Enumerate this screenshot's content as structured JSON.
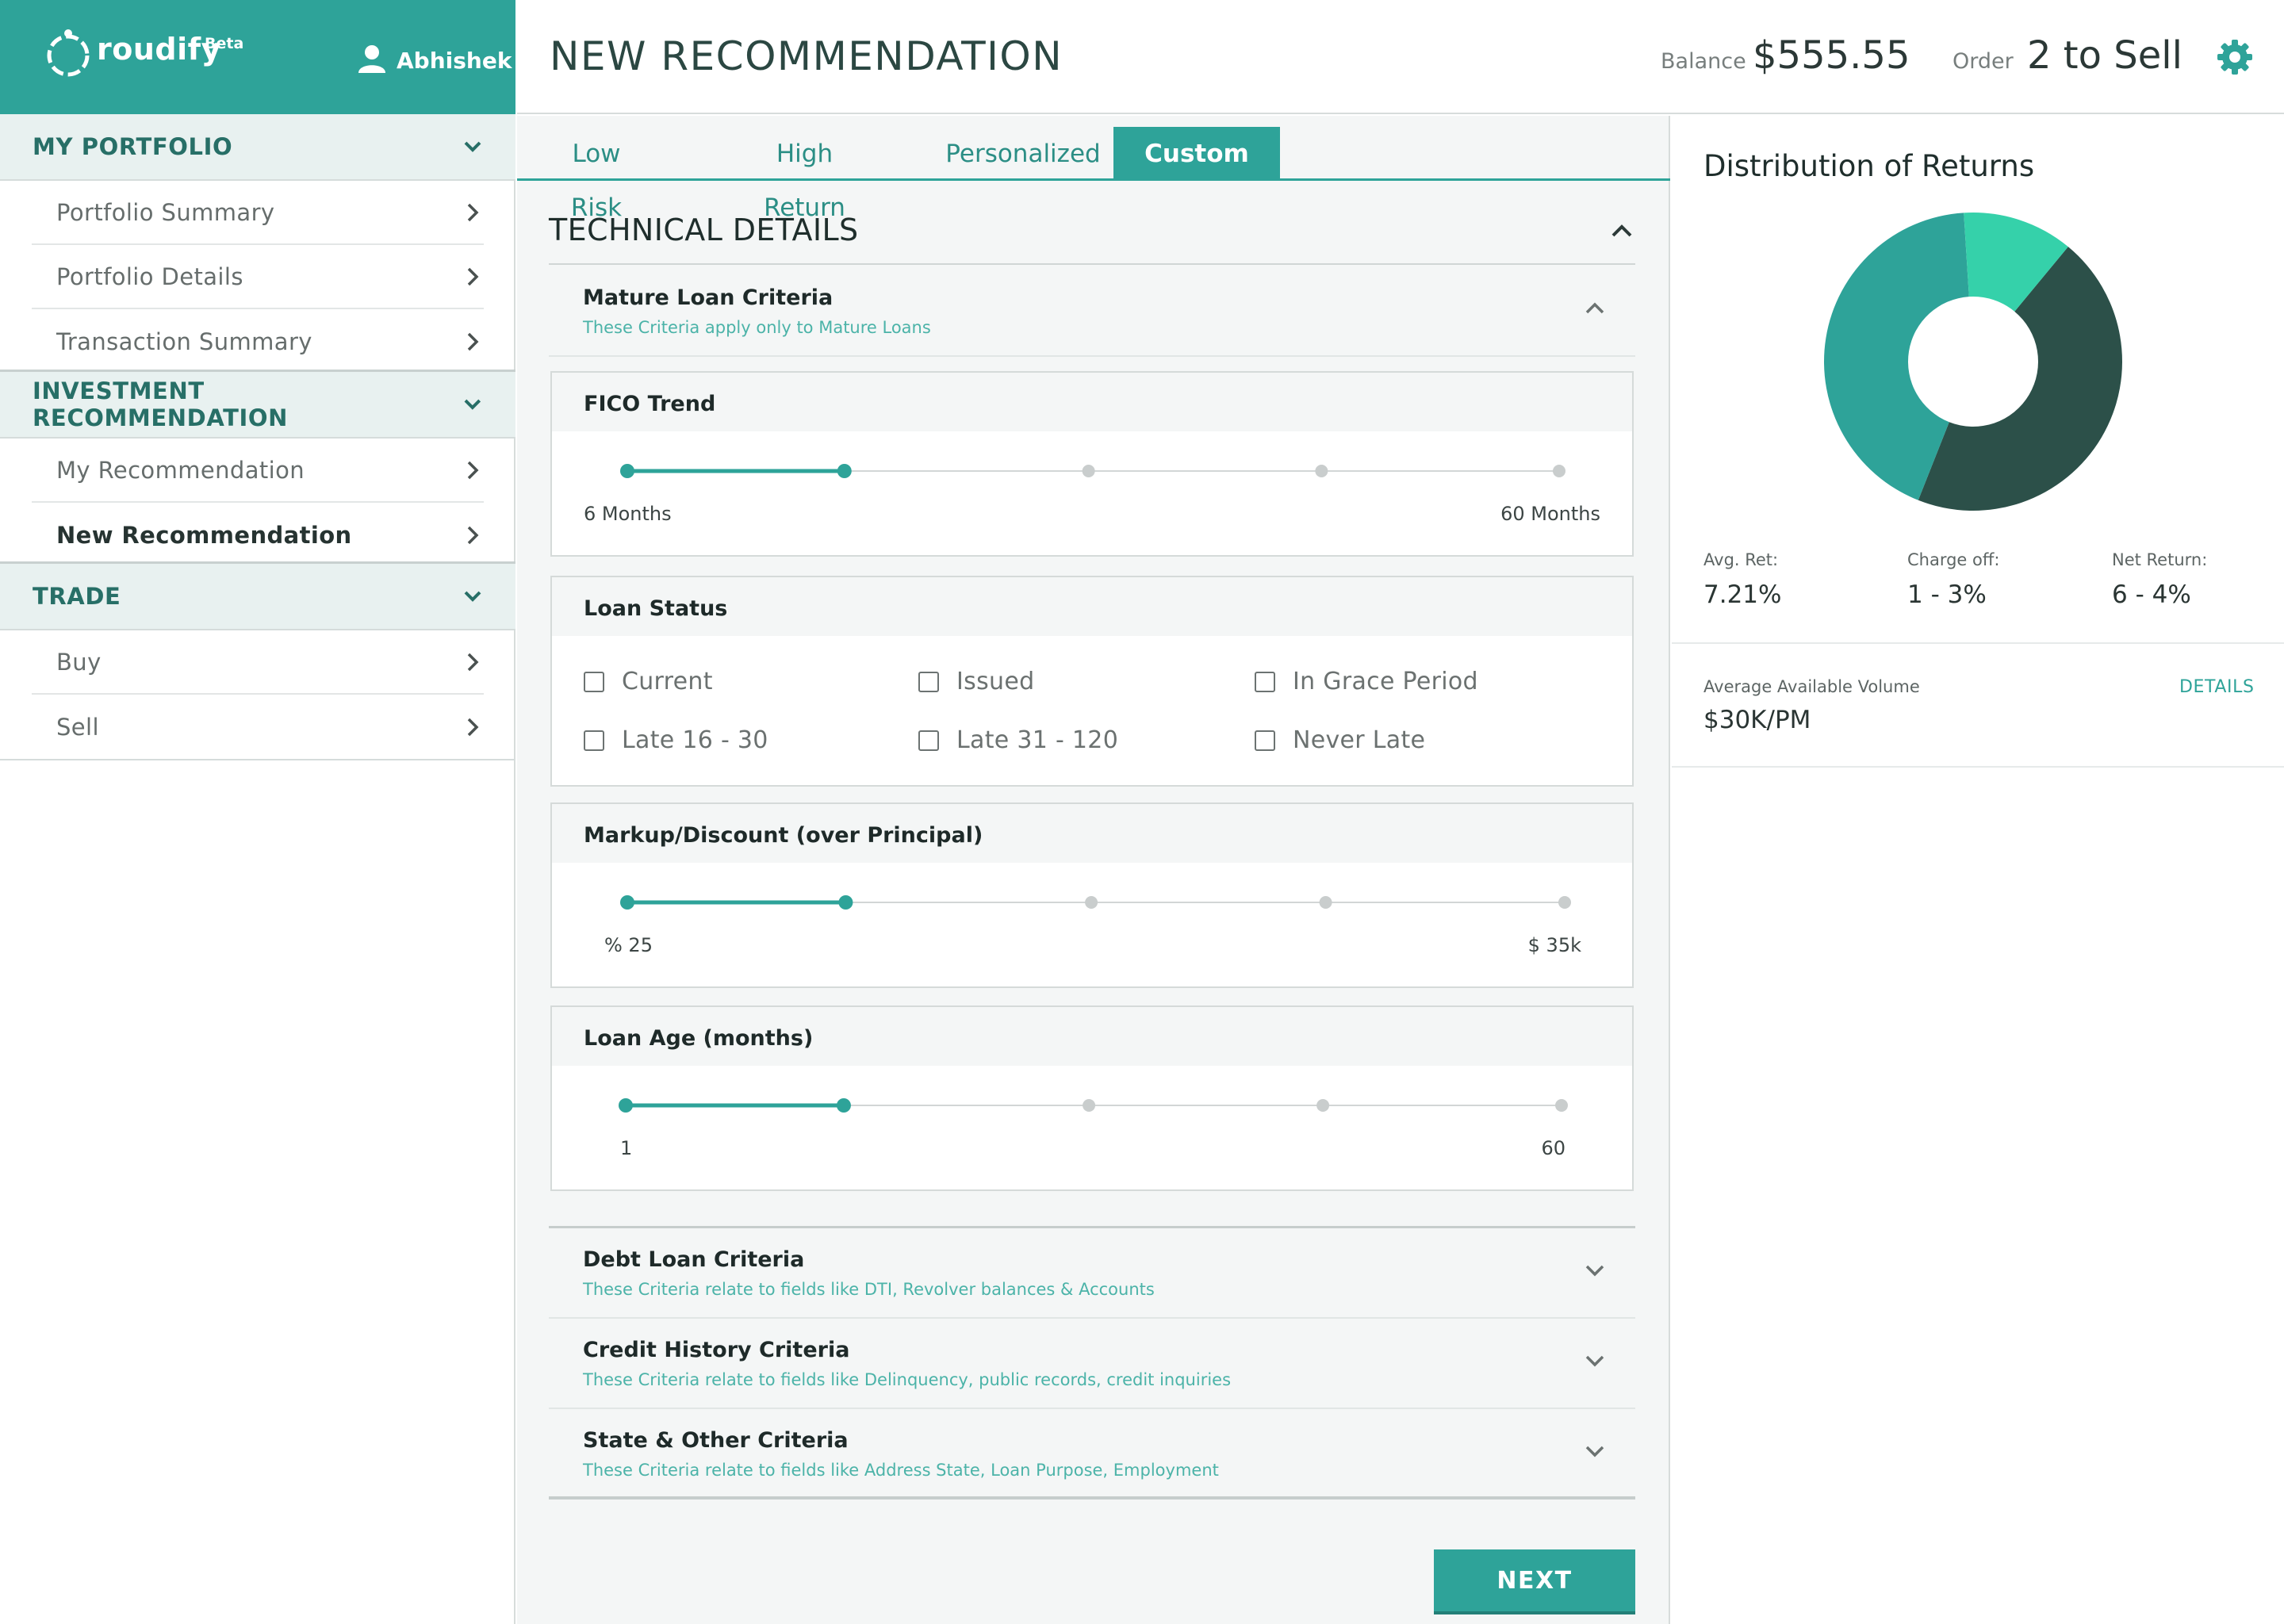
{
  "brand": {
    "name": "roudify",
    "tag": "Beta",
    "user": "Abhishek"
  },
  "sidebar": {
    "sections": [
      {
        "label": "MY PORTFOLIO",
        "items": [
          {
            "label": "Portfolio Summary"
          },
          {
            "label": "Portfolio Details"
          },
          {
            "label": "Transaction Summary"
          }
        ]
      },
      {
        "label": "INVESTMENT RECOMMENDATION",
        "items": [
          {
            "label": "My Recommendation"
          },
          {
            "label": "New Recommendation",
            "active": true
          }
        ]
      },
      {
        "label": "TRADE",
        "items": [
          {
            "label": "Buy"
          },
          {
            "label": "Sell"
          }
        ]
      }
    ]
  },
  "header": {
    "title": "NEW RECOMMENDATION",
    "balance_label": "Balance",
    "balance_value": "$555.55",
    "order_label": "Order",
    "order_value": "2 to Sell"
  },
  "tabs": [
    {
      "label": "Low Risk"
    },
    {
      "label": "High Return"
    },
    {
      "label": "Personalized"
    },
    {
      "label": "Custom",
      "active": true
    }
  ],
  "technical": {
    "title": "TECHNICAL DETAILS",
    "mature": {
      "title": "Mature Loan Criteria",
      "subtitle": "These Criteria apply only to Mature Loans"
    },
    "fico": {
      "title": "FICO Trend",
      "min": "6 Months",
      "max": "60 Months",
      "steps": 5,
      "selected_range": [
        0,
        1
      ]
    },
    "loan_status": {
      "title": "Loan Status",
      "options": [
        {
          "label": "Current",
          "checked": false
        },
        {
          "label": "Issued",
          "checked": false
        },
        {
          "label": "In Grace Period",
          "checked": false
        },
        {
          "label": "Late 16 - 30",
          "checked": false
        },
        {
          "label": "Late 31 - 120",
          "checked": false
        },
        {
          "label": "Never Late",
          "checked": false
        }
      ]
    },
    "markup": {
      "title": "Markup/Discount (over Principal)",
      "min": "% 25",
      "max": "$ 35k",
      "steps": 5,
      "selected_range": [
        0,
        1
      ]
    },
    "loan_age": {
      "title": "Loan Age (months)",
      "min": "1",
      "max": "60",
      "steps": 5,
      "selected_range": [
        0,
        1
      ]
    },
    "collapsed": [
      {
        "title": "Debt Loan Criteria",
        "subtitle": "These Criteria relate to fields like DTI, Revolver balances & Accounts"
      },
      {
        "title": "Credit History Criteria",
        "subtitle": "These Criteria relate to fields like Delinquency, public records, credit inquiries"
      },
      {
        "title": "State & Other Criteria",
        "subtitle": "These Criteria relate to fields like Address State, Loan Purpose, Employment"
      }
    ],
    "next_label": "NEXT"
  },
  "distribution": {
    "title": "Distribution of Returns",
    "stats": [
      {
        "label": "Avg. Ret:",
        "value": "7.21%"
      },
      {
        "label": "Charge off:",
        "value": "1 - 3%"
      },
      {
        "label": "Net Return:",
        "value": "6 - 4%"
      }
    ],
    "volume_label": "Average Available Volume",
    "volume_value": "$30K/PM",
    "details_label": "DETAILS"
  },
  "chart_data": {
    "type": "pie",
    "title": "Distribution of Returns",
    "labels": [],
    "values": [
      45,
      43,
      12
    ],
    "colors": [
      "#2c5049",
      "#2ea399",
      "#35d1aa"
    ]
  },
  "colors": {
    "accent": "#2ea399",
    "accent_dark": "#276f67",
    "accent_light": "#35d1aa"
  }
}
